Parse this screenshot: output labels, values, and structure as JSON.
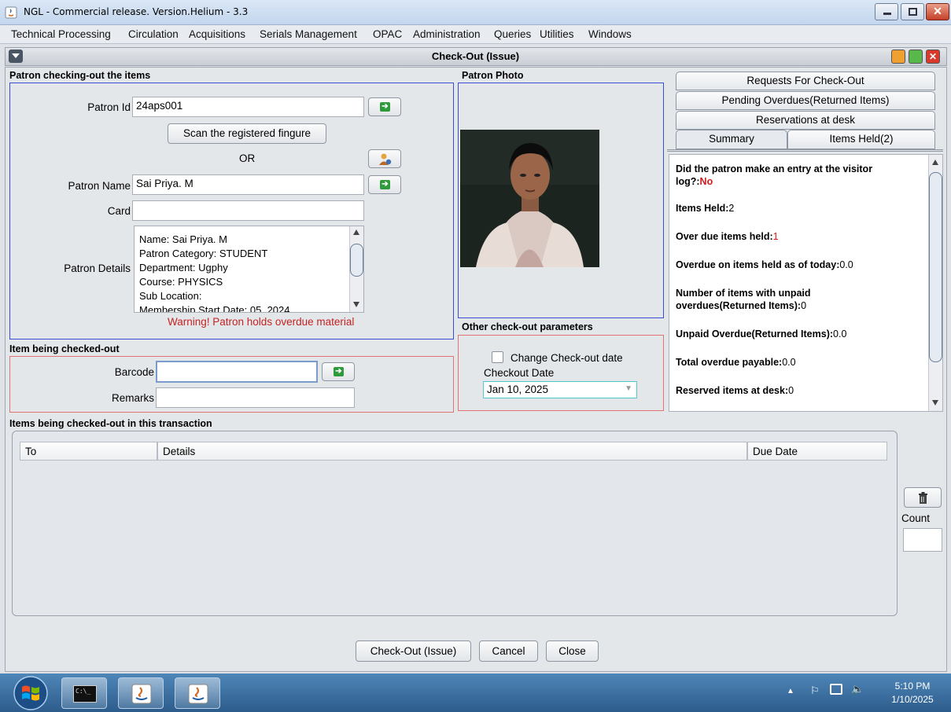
{
  "window": {
    "title": "NGL - Commercial release. Version.Helium - 3.3"
  },
  "menu": [
    "Technical Processing",
    "Circulation",
    "Acquisitions",
    "Serials Management",
    "OPAC",
    "Administration",
    "Queries",
    "Utilities",
    "Windows"
  ],
  "frame": {
    "title": "Check-Out (Issue)"
  },
  "patron": {
    "section_title": "Patron checking-out the items",
    "id_label": "Patron Id",
    "id_value": "24aps001",
    "scan_button": "Scan the registered fingure",
    "or_text": "OR",
    "name_label": "Patron Name",
    "name_value": "Sai Priya. M",
    "card_label": "Card",
    "card_value": "",
    "details_label": "Patron Details",
    "details_lines": [
      "Name: Sai Priya. M",
      "Patron Category: STUDENT",
      "Department: Ugphy",
      "Course: PHYSICS",
      "Sub Location:",
      "Membership Start Date: 05, 2024"
    ],
    "warning": "Warning! Patron holds overdue material"
  },
  "photo": {
    "section_title": "Patron Photo"
  },
  "item": {
    "section_title": "Item being checked-out",
    "barcode_label": "Barcode",
    "barcode_value": "",
    "remarks_label": "Remarks",
    "remarks_value": ""
  },
  "other_params": {
    "section_title": "Other check-out parameters",
    "change_date_label": "Change Check-out date",
    "change_date_checked": false,
    "checkout_date_label": "Checkout Date",
    "checkout_date_value": "Jan 10, 2025"
  },
  "tabs": {
    "requests": "Requests For Check-Out",
    "pending": "Pending Overdues(Returned Items)",
    "reservations": "Reservations at desk",
    "summary": "Summary",
    "items_held": "Items Held(2)"
  },
  "summary": {
    "visitor_log_label_1": "Did the patron make an entry at the visitor",
    "visitor_log_label_2": "log?:",
    "visitor_log_value": "No",
    "items_held_label": "Items Held:",
    "items_held_value": "2",
    "overdue_items_label": "Over due items held:",
    "overdue_items_value": "1",
    "overdue_today_label": "Overdue on items held as of today:",
    "overdue_today_value": "0.0",
    "unpaid_count_label_1": "Number of items with unpaid",
    "unpaid_count_label_2": "overdues(Returned Items):",
    "unpaid_count_value": "0",
    "unpaid_overdue_label": "Unpaid Overdue(Returned Items):",
    "unpaid_overdue_value": "0.0",
    "total_payable_label": "Total overdue payable:",
    "total_payable_value": "0.0",
    "reserved_label": "Reserved items at desk:",
    "reserved_value": "0"
  },
  "transaction": {
    "section_title": "Items being checked-out in this transaction",
    "columns": [
      "To",
      "Details",
      "Due Date"
    ],
    "rows": [],
    "count_label": "Count",
    "count_value": ""
  },
  "buttons": {
    "checkout": "Check-Out (Issue)",
    "cancel": "Cancel",
    "close": "Close"
  },
  "taskbar": {
    "time": "5:10 PM",
    "date": "1/10/2025"
  }
}
